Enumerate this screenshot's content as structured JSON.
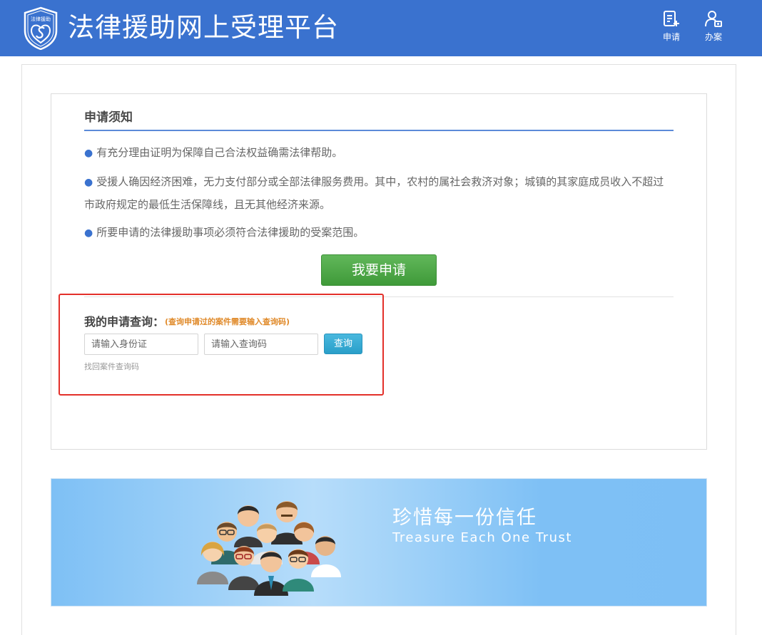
{
  "header": {
    "site_title": "法律援助网上受理平台",
    "logo_text": "法律援助",
    "nav": [
      {
        "label": "申请",
        "icon": "apply-document-icon"
      },
      {
        "label": "办案",
        "icon": "case-handling-icon"
      }
    ],
    "bg_color": "#3a72cf"
  },
  "notice": {
    "title": "申请须知",
    "items": [
      "有充分理由证明为保障自己合法权益确需法律帮助。",
      "受援人确因经济困难，无力支付部分或全部法律服务费用。其中，农村的属社会救济对象；城镇的其家庭成员收入不超过市政府规定的最低生活保障线，且无其他经济来源。",
      "所要申请的法律援助事项必须符合法律援助的受案范围。"
    ],
    "apply_button": "我要申请"
  },
  "query": {
    "title": "我的申请查询：",
    "hint": "(查询申请过的案件需要输入查询码)",
    "id_placeholder": "请输入身份证",
    "code_placeholder": "请输入查询码",
    "submit_label": "查询",
    "recover_link": "找回案件查询码",
    "highlight_color": "#e3302a"
  },
  "banner": {
    "title_cn": "珍惜每一份信任",
    "title_en": "Treasure Each One Trust"
  }
}
